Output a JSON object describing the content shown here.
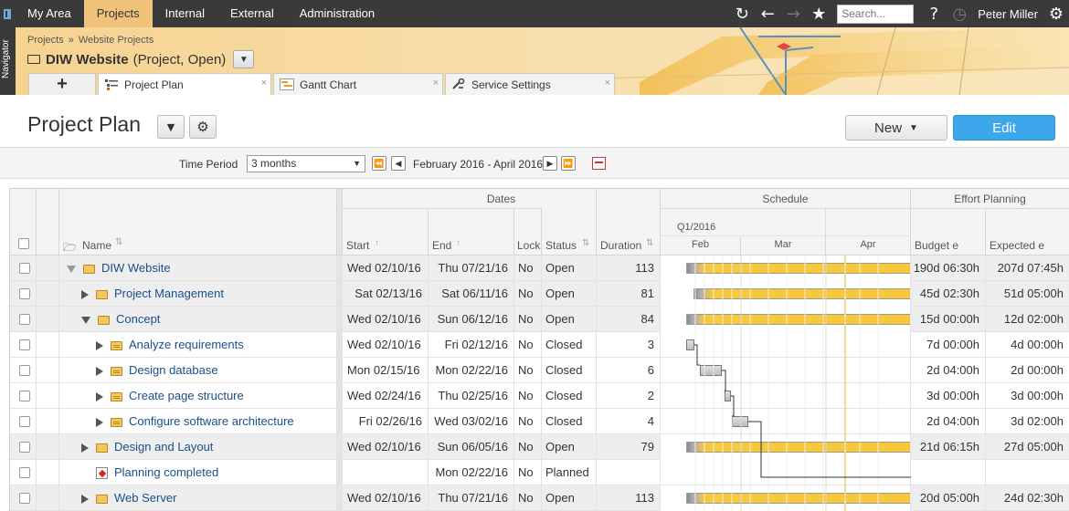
{
  "topnav": {
    "tabs": [
      "My Area",
      "Projects",
      "Internal",
      "External",
      "Administration"
    ],
    "active_tab": "Projects",
    "search_placeholder": "Search...",
    "user": "Peter Miller",
    "icons": [
      "refresh-icon",
      "back-icon",
      "forward-icon",
      "favorites-star-icon",
      "help-icon",
      "stopwatch-icon",
      "settings-gear-icon"
    ]
  },
  "navigator_label": "Navigator",
  "breadcrumb": [
    "Projects",
    "Website Projects"
  ],
  "breadcrumb_sep": "»",
  "project": {
    "name": "DIW Website",
    "meta": "(Project, Open)"
  },
  "tabs": [
    {
      "label": "Project Plan",
      "active": true
    },
    {
      "label": "Gantt Chart",
      "active": false
    },
    {
      "label": "Service Settings",
      "active": false
    }
  ],
  "add_tab_label": "+",
  "close_glyph": "×",
  "page": {
    "title": "Project Plan",
    "new_label": "New",
    "edit_label": "Edit"
  },
  "time_period": {
    "label": "Time Period",
    "selected": "3 months",
    "range": "February 2016 - April 2016"
  },
  "grid": {
    "groups": {
      "dates": "Dates",
      "schedule": "Schedule",
      "effort": "Effort Planning"
    },
    "columns": {
      "name": "Name",
      "start": "Start",
      "end": "End",
      "lock": "Lock",
      "status": "Status",
      "duration": "Duration",
      "budget": "Budget e",
      "expected": "Expected e"
    },
    "quarter": "Q1/2016",
    "months": [
      "Feb",
      "Mar",
      "Apr"
    ],
    "rows": [
      {
        "name": "DIW Website",
        "level": 0,
        "toggle": "down-light",
        "icon": "folder",
        "start": "Wed 02/10/16",
        "end": "Thu 07/21/16",
        "lock": "No",
        "status": "Open",
        "duration": "113",
        "budget": "190d 06:30h",
        "expected": "207d 07:45h"
      },
      {
        "name": "Project Management",
        "level": 1,
        "toggle": "right",
        "icon": "folder",
        "start": "Sat 02/13/16",
        "end": "Sat 06/11/16",
        "lock": "No",
        "status": "Open",
        "duration": "81",
        "budget": "45d 02:30h",
        "expected": "51d 05:00h"
      },
      {
        "name": "Concept",
        "level": 1,
        "toggle": "down",
        "icon": "folder",
        "start": "Wed 02/10/16",
        "end": "Sun 06/12/16",
        "lock": "No",
        "status": "Open",
        "duration": "84",
        "budget": "15d 00:00h",
        "expected": "12d 02:00h"
      },
      {
        "name": "Analyze requirements",
        "level": 2,
        "toggle": "right",
        "icon": "task",
        "start": "Wed 02/10/16",
        "end": "Fri 02/12/16",
        "lock": "No",
        "status": "Closed",
        "duration": "3",
        "budget": "7d 00:00h",
        "expected": "4d 00:00h"
      },
      {
        "name": "Design database",
        "level": 2,
        "toggle": "right",
        "icon": "task",
        "start": "Mon 02/15/16",
        "end": "Mon 02/22/16",
        "lock": "No",
        "status": "Closed",
        "duration": "6",
        "budget": "2d 04:00h",
        "expected": "2d 00:00h"
      },
      {
        "name": "Create page structure",
        "level": 2,
        "toggle": "right",
        "icon": "task",
        "start": "Wed 02/24/16",
        "end": "Thu 02/25/16",
        "lock": "No",
        "status": "Closed",
        "duration": "2",
        "budget": "3d 00:00h",
        "expected": "3d 00:00h"
      },
      {
        "name": "Configure software architecture",
        "level": 2,
        "toggle": "right",
        "icon": "task",
        "start": "Fri 02/26/16",
        "end": "Wed 03/02/16",
        "lock": "No",
        "status": "Closed",
        "duration": "4",
        "budget": "2d 04:00h",
        "expected": "3d 02:00h"
      },
      {
        "name": "Design and Layout",
        "level": 1,
        "toggle": "right",
        "icon": "folder",
        "start": "Wed 02/10/16",
        "end": "Sun 06/05/16",
        "lock": "No",
        "status": "Open",
        "duration": "79",
        "budget": "21d 06:15h",
        "expected": "27d 05:00h"
      },
      {
        "name": "Planning completed",
        "level": 1,
        "toggle": "none",
        "icon": "milestone",
        "start": "",
        "end": "Mon 02/22/16",
        "lock": "No",
        "status": "Planned",
        "duration": "",
        "budget": "",
        "expected": ""
      },
      {
        "name": "Web Server",
        "level": 1,
        "toggle": "right",
        "icon": "folder",
        "start": "Wed 02/10/16",
        "end": "Thu 07/21/16",
        "lock": "No",
        "status": "Open",
        "duration": "113",
        "budget": "20d 05:00h",
        "expected": "24d 02:30h"
      }
    ]
  },
  "colors": {
    "accent": "#3ca7ea",
    "header_band": "#f6d28f",
    "topnav": "#3a3a3a",
    "gantt_bar": "#f7c83a",
    "link": "#1a4f8a"
  }
}
